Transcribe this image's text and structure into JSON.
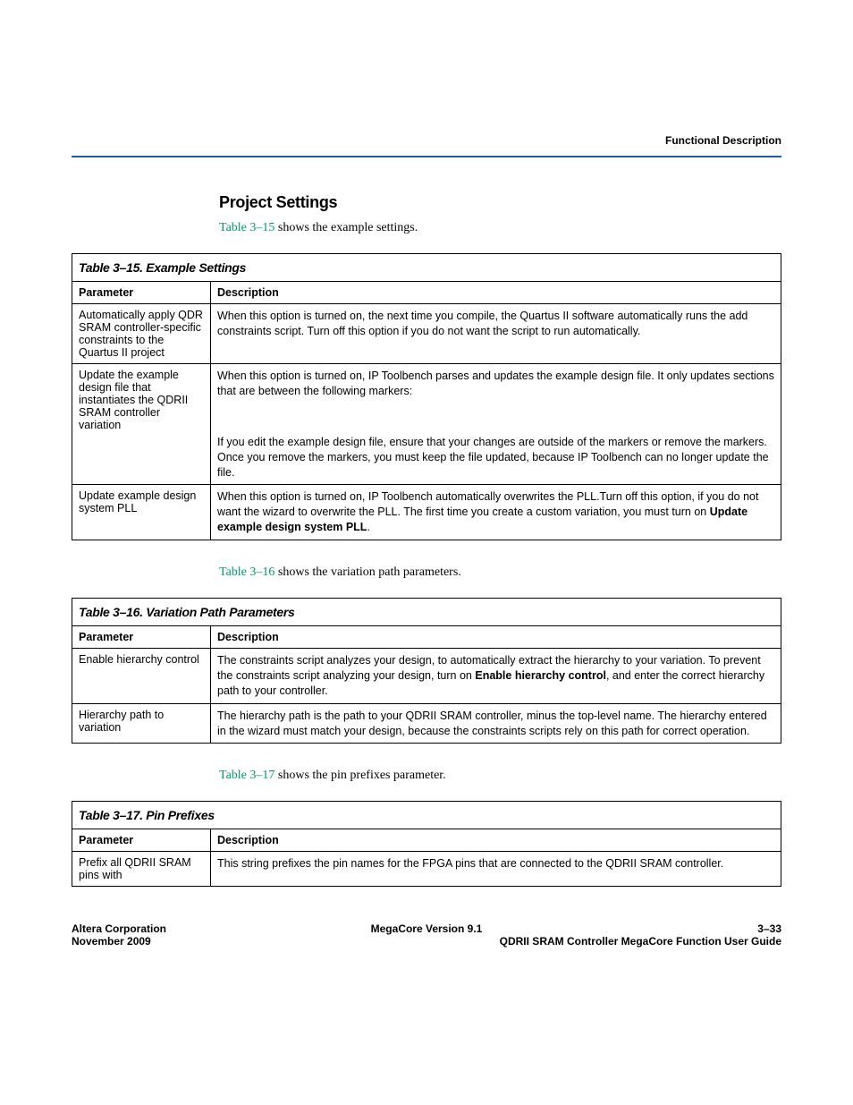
{
  "header": {
    "right": "Functional Description"
  },
  "section": {
    "title": "Project Settings"
  },
  "intros": {
    "i15_ref": "Table 3–15",
    "i15_tail": " shows the example settings.",
    "i16_ref": "Table 3–16",
    "i16_tail": " shows the variation path parameters.",
    "i17_ref": "Table 3–17",
    "i17_tail": " shows the pin prefixes parameter."
  },
  "cols": {
    "parameter": "Parameter",
    "description": "Description"
  },
  "table15": {
    "caption": "Table 3–15. Example Settings",
    "rows": [
      {
        "param": "Automatically apply QDR SRAM controller-specific constraints to the Quartus II project",
        "desc": "When this option is turned on, the next time you compile, the Quartus II software automatically runs the add constraints script. Turn off this option if you do not want the script to run automatically."
      },
      {
        "param": "Update the example design file that instantiates the QDRII SRAM controller variation",
        "desc1": "When this option is turned on, IP Toolbench parses and updates the example design file. It only updates sections that are between the following markers:",
        "desc2": "If you edit the example design file, ensure that your changes are outside of the markers or remove the markers. Once you remove the markers, you must keep the file updated, because IP Toolbench can no longer update the file."
      },
      {
        "param": "Update example design system PLL",
        "desc_a": "When this option is turned on, IP Toolbench automatically overwrites the PLL.Turn off this option, if you do not want the wizard to overwrite the PLL. The first time you create a custom variation, you must turn on ",
        "desc_b": "Update example design system PLL",
        "desc_c": "."
      }
    ]
  },
  "table16": {
    "caption": "Table 3–16. Variation Path Parameters",
    "rows": [
      {
        "param": "Enable hierarchy control",
        "desc_a": "The constraints script analyzes your design, to automatically extract the hierarchy to your variation. To prevent the constraints script analyzing your design, turn on ",
        "desc_b": "Enable hierarchy control",
        "desc_c": ", and enter the correct hierarchy path to your controller."
      },
      {
        "param": "Hierarchy path to variation",
        "desc": "The hierarchy path is the path to your QDRII SRAM controller, minus the top-level name. The hierarchy entered in the wizard must match your design, because the constraints scripts rely on this path for correct operation."
      }
    ]
  },
  "table17": {
    "caption": "Table 3–17. Pin Prefixes",
    "rows": [
      {
        "param": "Prefix all QDRII SRAM pins with",
        "desc": "This string prefixes the pin names for the FPGA pins that are connected to the QDRII SRAM controller."
      }
    ]
  },
  "footer": {
    "left1": "Altera Corporation",
    "left2": "November 2009",
    "center": "MegaCore Version 9.1",
    "right1": "3–33",
    "right2": "QDRII SRAM Controller MegaCore Function User Guide"
  }
}
